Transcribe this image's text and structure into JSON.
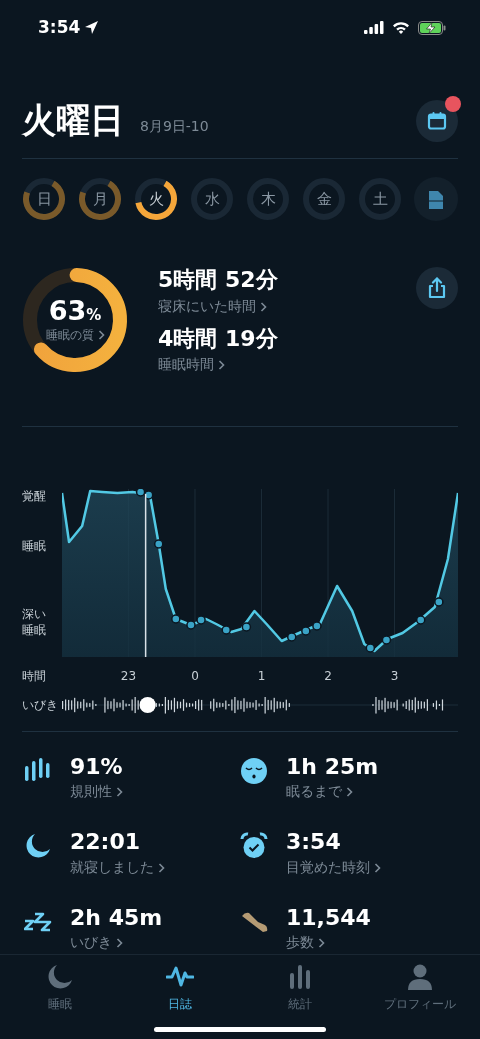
{
  "status_bar": {
    "time": "3:54"
  },
  "header": {
    "title": "火曜日",
    "date_range": "8月9日-10",
    "calendar_notification": true
  },
  "days": [
    {
      "label": "日",
      "recorded": true,
      "selected": false
    },
    {
      "label": "月",
      "recorded": true,
      "selected": false
    },
    {
      "label": "火",
      "recorded": true,
      "selected": true
    },
    {
      "label": "水",
      "recorded": false,
      "selected": false
    },
    {
      "label": "木",
      "recorded": false,
      "selected": false
    },
    {
      "label": "金",
      "recorded": false,
      "selected": false
    },
    {
      "label": "土",
      "recorded": false,
      "selected": false
    }
  ],
  "summary": {
    "quality": {
      "value": "63",
      "unit": "%",
      "label": "睡眠の質"
    },
    "metrics": [
      {
        "value": "5時間 52分",
        "label": "寝床にいた時間"
      },
      {
        "value": "4時間 19分",
        "label": "睡眠時間"
      }
    ]
  },
  "sleep_graph": {
    "stage_labels": [
      "覚醒",
      "睡眠",
      "深い睡眠"
    ],
    "time_label": "時間",
    "time_ticks": [
      "23",
      "0",
      "1",
      "2",
      "3"
    ],
    "snore_label": "いびき"
  },
  "stats": [
    {
      "kind": "regularity",
      "value": "91%",
      "label": "規則性"
    },
    {
      "kind": "fall-asleep",
      "value": "1h 25m",
      "label": "眠るまで"
    },
    {
      "kind": "bedtime",
      "value": "22:01",
      "label": "就寝しました"
    },
    {
      "kind": "wake",
      "value": "3:54",
      "label": "目覚めた時刻"
    },
    {
      "kind": "snore",
      "value": "2h 45m",
      "label": "いびき"
    },
    {
      "kind": "steps",
      "value": "11,544",
      "label": "歩数"
    }
  ],
  "tabs": [
    {
      "kind": "sleep",
      "label": "睡眠",
      "selected": false
    },
    {
      "kind": "journal",
      "label": "日誌",
      "selected": true
    },
    {
      "kind": "stats",
      "label": "統計",
      "selected": false
    },
    {
      "kind": "profile",
      "label": "プロフィール",
      "selected": false
    }
  ]
}
